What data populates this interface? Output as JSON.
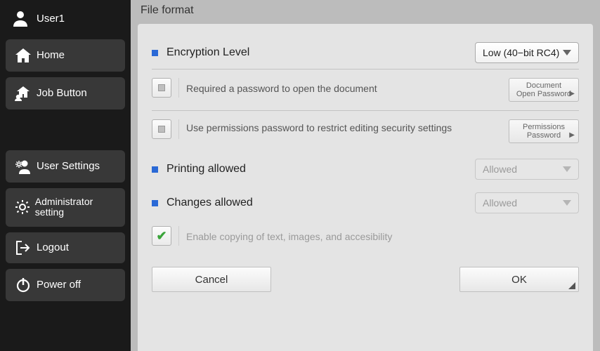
{
  "sidebar": {
    "user": "User1",
    "items": [
      "Home",
      "Job Button",
      "User Settings",
      "Administrator setting",
      "Logout",
      "Power off"
    ]
  },
  "header": {
    "title": "File format"
  },
  "encryption": {
    "title": "Encryption Level",
    "value": "Low (40−bit RC4)",
    "opt1_label": "Required a password to open the document",
    "opt1_btn_l1": "Document",
    "opt1_btn_l2": "Open Password",
    "opt2_label": "Use permissions password to restrict editing security settings",
    "opt2_btn_l1": "Permissions",
    "opt2_btn_l2": "Password"
  },
  "printing": {
    "title": "Printing allowed",
    "value": "Allowed"
  },
  "changes": {
    "title": "Changes allowed",
    "value": "Allowed",
    "opt_label": "Enable copying of text, images, and accesibility"
  },
  "footer": {
    "cancel": "Cancel",
    "ok": "OK"
  }
}
